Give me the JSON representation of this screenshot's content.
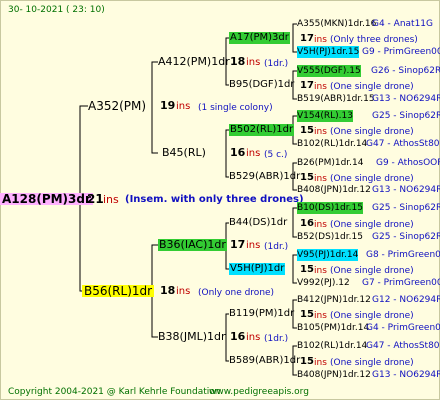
{
  "header": {
    "date": "30- 10-2021 ( 23: 10)",
    "watermark": "www.pedigreeapis.org"
  },
  "footer": {
    "copyright": "Copyright 2004-2021 @ Karl Kehrle Foundation",
    "site": "www.pedigreeapis.org"
  },
  "root": {
    "name": "A128(PM)3dr",
    "num": "21",
    "ins": "ins",
    "note": "(Insem. with only three drones)"
  },
  "g1": [
    {
      "name": "A352(PM)",
      "num": "19",
      "ins": "ins",
      "note": "(1 single colony)"
    },
    {
      "name": "B56(RL)1dr",
      "num": "18",
      "ins": "ins",
      "note": "(Only one drone)"
    }
  ],
  "g2": [
    {
      "name": "A412(PM)1dr",
      "num": "18",
      "ins": "ins",
      "note": "(1dr.)"
    },
    {
      "name": "B45(RL)",
      "num": "16",
      "ins": "ins",
      "note": "(5 c.)"
    },
    {
      "name": "B36(IAC)1dr",
      "num": "17",
      "ins": "ins",
      "note": "(1dr.)"
    },
    {
      "name": "B38(JML)1dr",
      "num": "16",
      "ins": "ins",
      "note": "(1dr.)"
    }
  ],
  "g3": [
    {
      "name": "A17(PM)3dr",
      "num": "17",
      "ins": "ins",
      "note": "(Only three drones)"
    },
    {
      "name": "B95(DGF)1dr",
      "num": "17",
      "ins": "ins",
      "note": "(One single drone)"
    },
    {
      "name": "B502(RL)1dr",
      "num": "15",
      "ins": "ins",
      "note": "(One single drone)"
    },
    {
      "name": "B529(ABR)1dr",
      "num": "15",
      "ins": "ins",
      "note": "(One single drone)"
    },
    {
      "name": "B44(DS)1dr",
      "num": "16",
      "ins": "ins",
      "note": "(One single drone)"
    },
    {
      "name": "V5H(PJ)1dr",
      "num": "15",
      "ins": "ins",
      "note": "(One single drone)"
    },
    {
      "name": "B119(PM)1dr",
      "num": "15",
      "ins": "ins",
      "note": "(One single drone)"
    },
    {
      "name": "B589(ABR)1dr",
      "num": "15",
      "ins": "ins",
      "note": "(One single drone)"
    }
  ],
  "g4": [
    {
      "name": "A355(MKN)1dr.16",
      "tail": "G4 - Anat11G"
    },
    {
      "name": "V5H(PJ)1dr.15",
      "tail": "G9 - PrimGreen00"
    },
    {
      "name": "V555(DGF).15",
      "tail": "G26 - Sinop62R"
    },
    {
      "name": "B519(ABR)1dr.15",
      "tail": "G13 - NO6294R"
    },
    {
      "name": "V154(RL).13",
      "tail": "G25 - Sinop62R"
    },
    {
      "name": "B102(RL)1dr.14",
      "tail": "G47 - AthosSt80R"
    },
    {
      "name": "B26(PM)1dr.14",
      "tail": "G9 - AthosOOR"
    },
    {
      "name": "B408(JPN)1dr.12",
      "tail": "G13 - NO6294R"
    },
    {
      "name": "B10(DS)1dr.15",
      "tail": "G25 - Sinop62R"
    },
    {
      "name": "B52(DS)1dr.15",
      "tail": "G25 - Sinop62R"
    },
    {
      "name": "V95(PJ)1dr.14",
      "tail": "G8 - PrimGreen00"
    },
    {
      "name": "V992(PJ).12",
      "tail": "G7 - PrimGreen00"
    },
    {
      "name": "B412(JPN)1dr.12",
      "tail": "G12 - NO6294R"
    },
    {
      "name": "B105(PM)1dr.14",
      "tail": "G4 - PrimGreen00"
    },
    {
      "name": "B102(RL)1dr.14",
      "tail": "G47 - AthosSt80R"
    },
    {
      "name": "B408(JPN)1dr.12",
      "tail": "G13 - NO6294R"
    }
  ],
  "colors": {
    "background": "#fffde0",
    "ins": "#c00000",
    "note": "#1010c0",
    "green_highlight": "#33cc33",
    "cyan_highlight": "#00e0ff",
    "pink_highlight": "#ffb0ff",
    "yellow_highlight": "#ffff00",
    "footer": "#007000"
  }
}
